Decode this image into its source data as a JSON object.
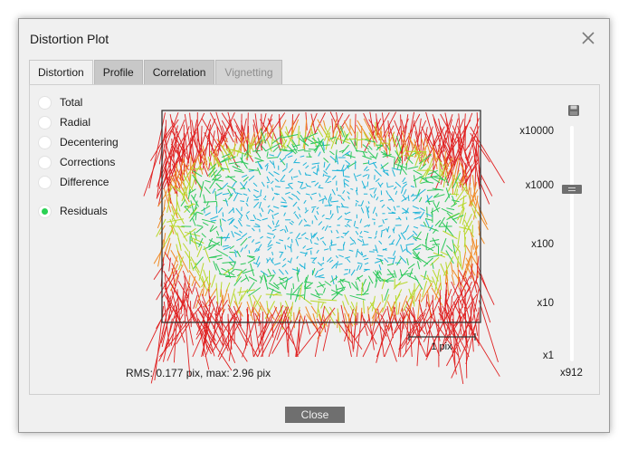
{
  "window": {
    "title": "Distortion Plot"
  },
  "tabs": [
    {
      "label": "Distortion",
      "state": "active"
    },
    {
      "label": "Profile",
      "state": "normal"
    },
    {
      "label": "Correlation",
      "state": "normal"
    },
    {
      "label": "Vignetting",
      "state": "disabled"
    }
  ],
  "modes": [
    {
      "label": "Total",
      "checked": false
    },
    {
      "label": "Radial",
      "checked": false
    },
    {
      "label": "Decentering",
      "checked": false
    },
    {
      "label": "Corrections",
      "checked": false
    },
    {
      "label": "Difference",
      "checked": false
    },
    {
      "label": "Residuals",
      "checked": true
    }
  ],
  "plot": {
    "scale_bar_label": "1 pix",
    "rms_text": "RMS: 0.177 pix, max: 2.96 pix",
    "vector_colors": [
      "#e02020",
      "#f08a24",
      "#b8d82a",
      "#2cc85a",
      "#1fb4d8"
    ]
  },
  "scale": {
    "labels": [
      "x10000",
      "x1000",
      "x100",
      "x10",
      "x1"
    ],
    "current": "x912",
    "level": 2.96
  },
  "buttons": {
    "close": "Close"
  },
  "icons": {
    "close": "close-icon",
    "save": "save-icon"
  }
}
